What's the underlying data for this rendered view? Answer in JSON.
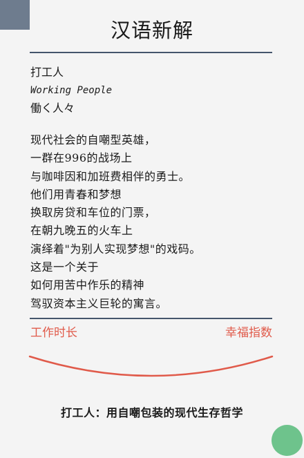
{
  "header": {
    "title": "汉语新解"
  },
  "entry": {
    "word": "打工人",
    "english": "Working People",
    "japanese": "働く人々"
  },
  "definition": {
    "lines": [
      "现代社会的自嘲型英雄，",
      "一群在996的战场上",
      "与咖啡因和加班费相伴的勇士。",
      "他们用青春和梦想",
      "换取房贷和车位的门票，",
      "在朝九晚五的火车上",
      "演绎着\"为别人实现梦想\"的戏码。",
      "这是一个关于",
      "如何用苦中作乐的精神",
      "驾驭资本主义巨轮的寓言。"
    ]
  },
  "graph": {
    "left_label": "工作时长",
    "right_label": "幸福指数",
    "curve_color": "#e05a4a"
  },
  "summary": {
    "text": "打工人：用自嘲包装的现代生存哲学"
  },
  "colors": {
    "background": "#f4f4f4",
    "accent_square": "#6e7c8e",
    "accent_circle": "#6ec38c",
    "rule": "#44556b",
    "label": "#e05a4a"
  }
}
